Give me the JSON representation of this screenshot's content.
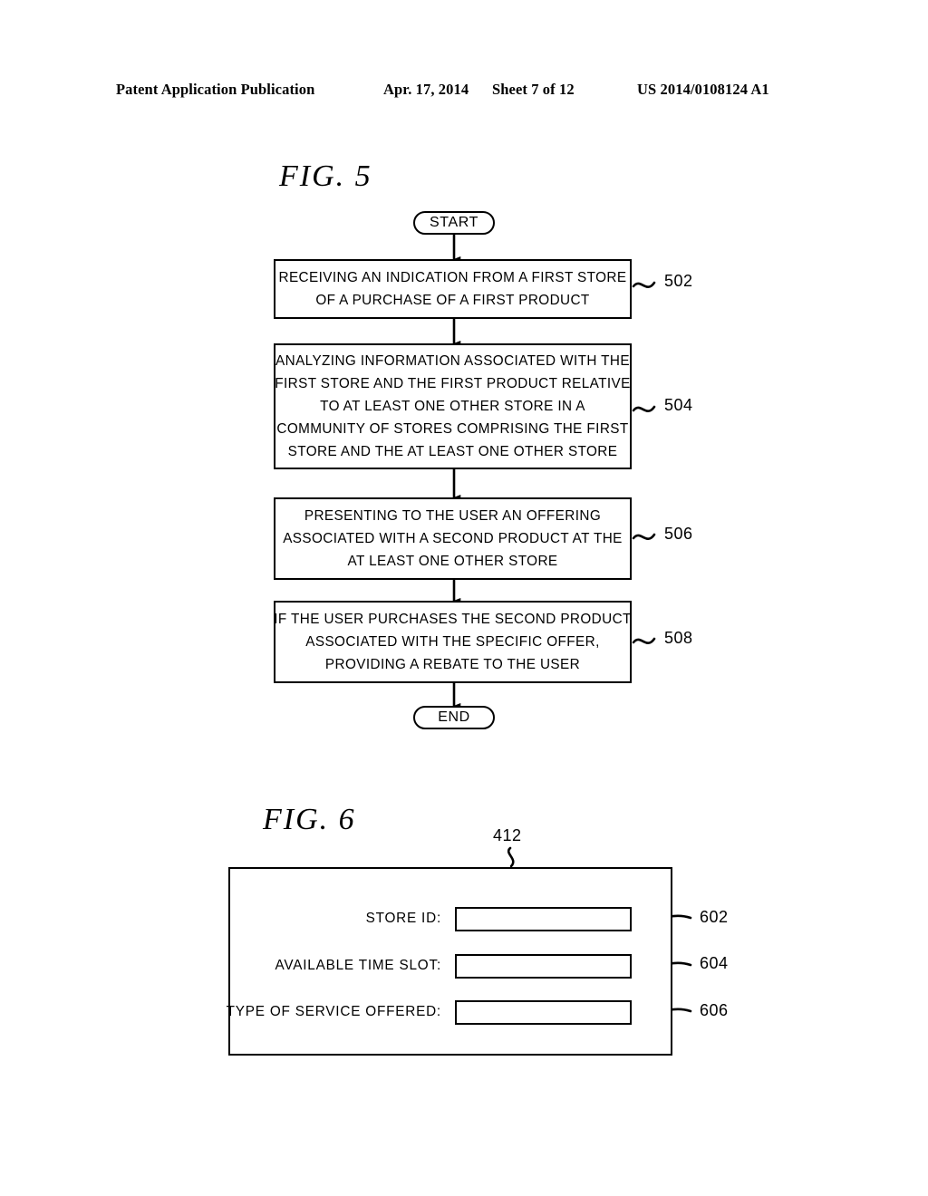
{
  "header": {
    "publication": "Patent Application Publication",
    "date": "Apr. 17, 2014",
    "sheet": "Sheet 7 of 12",
    "patent_number": "US 2014/0108124 A1"
  },
  "figures": [
    {
      "id": "fig5",
      "title": "FIG. 5",
      "type": "flowchart",
      "nodes": [
        {
          "id": "start",
          "shape": "terminator",
          "label": "START"
        },
        {
          "id": "502",
          "shape": "process",
          "ref": "502",
          "lines": [
            "RECEIVING AN INDICATION FROM A FIRST STORE",
            "OF A PURCHASE OF A FIRST PRODUCT"
          ]
        },
        {
          "id": "504",
          "shape": "process",
          "ref": "504",
          "lines": [
            "ANALYZING INFORMATION ASSOCIATED WITH THE",
            "FIRST STORE AND THE FIRST PRODUCT RELATIVE",
            "TO AT LEAST ONE OTHER STORE IN A",
            "COMMUNITY OF STORES COMPRISING THE FIRST",
            "STORE AND THE AT LEAST ONE OTHER STORE"
          ]
        },
        {
          "id": "506",
          "shape": "process",
          "ref": "506",
          "lines": [
            "PRESENTING TO THE USER AN OFFERING",
            "ASSOCIATED WITH A SECOND PRODUCT AT THE",
            "AT LEAST ONE OTHER STORE"
          ]
        },
        {
          "id": "508",
          "shape": "process",
          "ref": "508",
          "lines": [
            "IF THE USER PURCHASES THE SECOND PRODUCT",
            "ASSOCIATED WITH THE SPECIFIC OFFER,",
            "PROVIDING A REBATE TO THE USER"
          ]
        },
        {
          "id": "end",
          "shape": "terminator",
          "label": "END"
        }
      ]
    },
    {
      "id": "fig6",
      "title": "FIG. 6",
      "type": "form-panel",
      "panel_ref": "412",
      "fields": [
        {
          "ref": "602",
          "label": "STORE ID:",
          "value": "",
          "placeholder": ""
        },
        {
          "ref": "604",
          "label": "AVAILABLE TIME SLOT:",
          "value": "",
          "placeholder": ""
        },
        {
          "ref": "606",
          "label": "TYPE OF SERVICE OFFERED:",
          "value": "",
          "placeholder": ""
        }
      ]
    }
  ],
  "colors": {
    "ink": "#000000",
    "paper": "#ffffff"
  }
}
